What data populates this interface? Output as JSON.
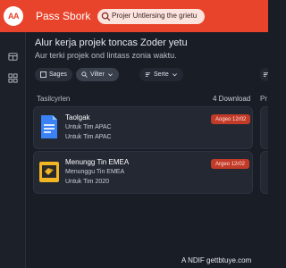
{
  "header": {
    "logo_text": "AA",
    "app_title": "Pass Sbork",
    "search_placeholder": "Projer Untlersing the grietu"
  },
  "main": {
    "title": "Alur kerja projek toncas Zoder yetu",
    "subtitle": "Aur terki projek ond lintass zonia waktu.",
    "filters": [
      {
        "label": "Sages"
      },
      {
        "label": "Vilter"
      },
      {
        "label": "Serte"
      }
    ],
    "section_label": "Tasilcyrlen",
    "download_label": "4 Download",
    "side_label": "Pr",
    "cards": [
      {
        "title": "Taolgak",
        "line1": "Untuk Tim APAC",
        "line2": "Untuk Tim APAC",
        "badge": "Aogeo 12r02",
        "icon": "document-icon",
        "icon_color": "#3b82f6"
      },
      {
        "title": "Menungg Tin EMEA",
        "line1": "Menunggu Tin EMEA",
        "line2": "Untuk Tim 2020",
        "badge": "Argeo 12r02",
        "icon": "folder-box-icon",
        "icon_color": "#f2b523"
      }
    ]
  },
  "footer": {
    "text": "A NDIF gettbtuye.com"
  },
  "colors": {
    "brand": "#e8442b",
    "background": "#191d26",
    "card": "#232833",
    "badge": "#c23a28"
  }
}
